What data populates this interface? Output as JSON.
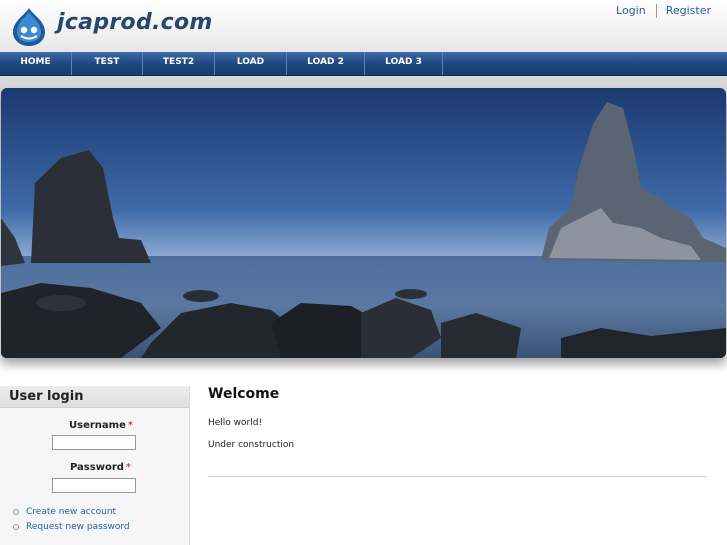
{
  "site": {
    "name": "jcaprod.com",
    "logo_icon": "drupal-drop-icon"
  },
  "user_links": {
    "login": "Login",
    "register": "Register"
  },
  "nav": {
    "items": [
      "HOME",
      "TEST",
      "TEST2",
      "LOAD",
      "LOAD 2",
      "LOAD 3"
    ]
  },
  "banner": {
    "image": "coastal-sea-stacks-at-dusk"
  },
  "sidebar": {
    "title": "User login",
    "username_label": "Username",
    "password_label": "Password",
    "required_marker": "*",
    "links": {
      "create_account": "Create new account",
      "request_password": "Request new password"
    }
  },
  "content": {
    "title": "Welcome",
    "paragraphs": [
      "Hello world!",
      "Under construction"
    ]
  },
  "colors": {
    "nav_bg": "#1e4680",
    "link": "#2a5da8",
    "site_name": "#27476a",
    "required": "#dd0000"
  }
}
